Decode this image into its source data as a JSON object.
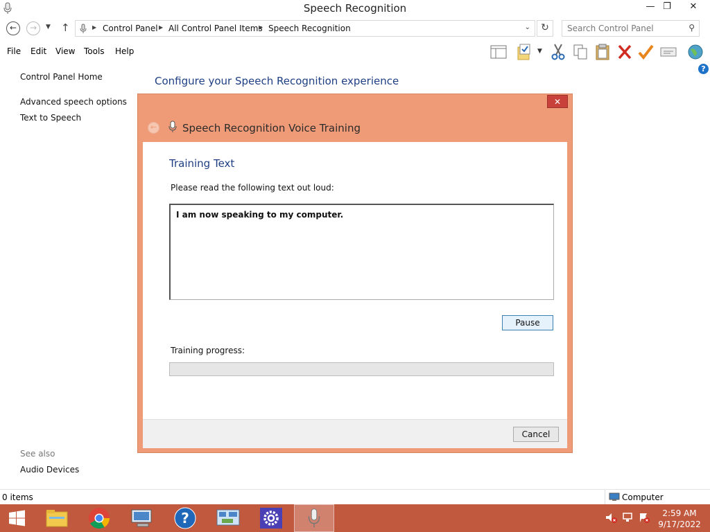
{
  "window": {
    "title": "Speech Recognition",
    "minimize_glyph": "—",
    "maximize_glyph": "❐",
    "close_glyph": "✕"
  },
  "address_bar": {
    "breadcrumbs": [
      "Control Panel",
      "All Control Panel Items",
      "Speech Recognition"
    ],
    "search_placeholder": "Search Control Panel"
  },
  "menu": [
    "File",
    "Edit",
    "View",
    "Tools",
    "Help"
  ],
  "toolbar_icons": [
    "layout-pane-icon",
    "folder-check-icon",
    "cut-icon",
    "copy-icon",
    "paste-icon",
    "delete-icon",
    "checkmark-icon",
    "properties-icon",
    "globe-icon"
  ],
  "sidebar": {
    "links": [
      "Control Panel Home",
      "Advanced speech options",
      "Text to Speech"
    ],
    "see_also_heading": "See also",
    "see_also_links": [
      "Audio Devices"
    ]
  },
  "main": {
    "heading": "Configure your Speech Recognition experience"
  },
  "dialog": {
    "title": "Speech Recognition Voice Training",
    "section_heading": "Training Text",
    "instruction": "Please read the following text out loud:",
    "speech_text": "I am now speaking to my computer.",
    "pause_label": "Pause",
    "progress_label": "Training progress:",
    "progress_fraction": 0,
    "cancel_label": "Cancel",
    "accent_color": "#f09b78"
  },
  "status_bar": {
    "items_text": "0 items",
    "location_text": "Computer"
  },
  "taskbar": {
    "apps": [
      "file-explorer-icon",
      "chrome-icon",
      "remote-desktop-icon",
      "help-icon",
      "network-icon",
      "settings-icon",
      "speech-recognition-icon"
    ],
    "tray": [
      "volume-muted-icon",
      "network-status-icon",
      "action-center-icon"
    ],
    "time": "2:59 AM",
    "date": "9/17/2022",
    "color": "#c1593f"
  }
}
